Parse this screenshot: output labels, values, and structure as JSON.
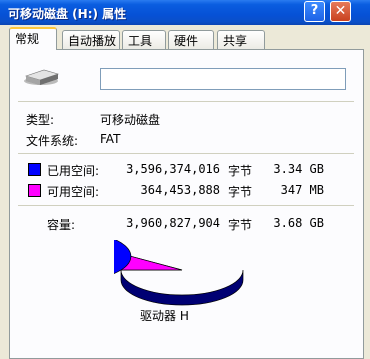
{
  "window": {
    "title": "可移动磁盘 (H:) 属性",
    "help_label": "?",
    "close_label": "✕"
  },
  "tabs": [
    "常规",
    "自动播放",
    "工具",
    "硬件",
    "共享"
  ],
  "general": {
    "volume_label_value": "",
    "type_label": "类型:",
    "type_value": "可移动磁盘",
    "fs_label": "文件系统:",
    "fs_value": "FAT",
    "used": {
      "label": "已用空间:",
      "bytes": "3,596,374,016",
      "unit": "字节",
      "size": "3.34 GB",
      "color": "#0000FF"
    },
    "free": {
      "label": "可用空间:",
      "bytes": "364,453,888",
      "unit": "字节",
      "size": "347 MB",
      "color": "#FF00FF"
    },
    "capacity": {
      "label": "容量:",
      "bytes": "3,960,827,904",
      "unit": "字节",
      "size": "3.68 GB"
    },
    "drive_label": "驱动器 H"
  },
  "chart_data": {
    "type": "pie",
    "categories": [
      "已用空间",
      "可用空间"
    ],
    "values": [
      3596374016,
      364453888
    ],
    "colors": [
      "#0000FF",
      "#FF00FF"
    ]
  }
}
